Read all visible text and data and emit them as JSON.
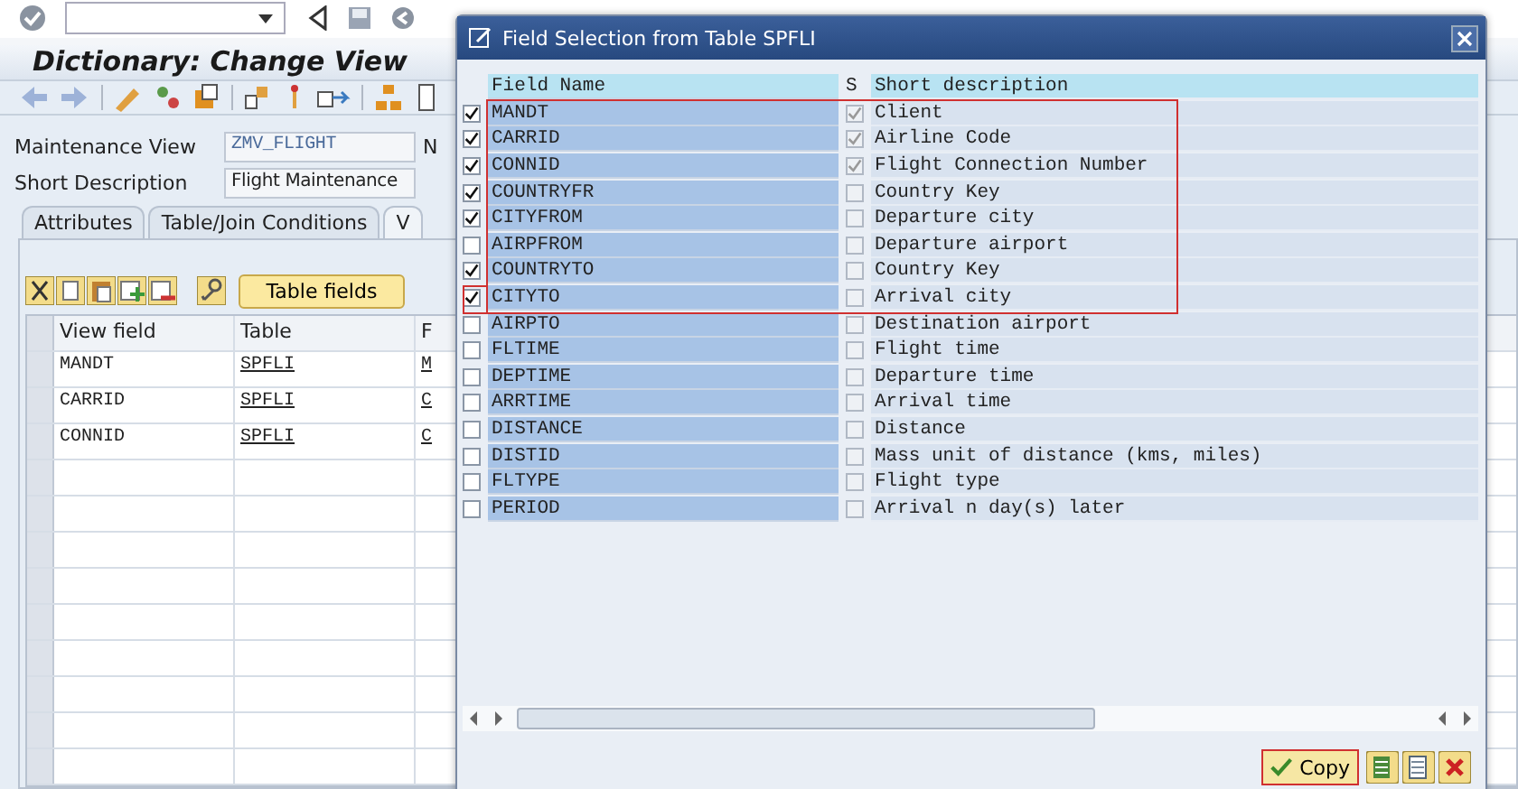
{
  "main": {
    "title": "Dictionary: Change View",
    "fields": [
      {
        "label": "Maintenance View",
        "value": "ZMV_FLIGHT",
        "next_label": "N"
      },
      {
        "label": "Short Description",
        "value": "Flight Maintenance"
      }
    ],
    "tabs": [
      {
        "label": "Attributes",
        "selected": false
      },
      {
        "label": "Table/Join Conditions",
        "selected": false
      },
      {
        "label": "V",
        "selected": true
      }
    ],
    "table_fields_button": "Table fields",
    "table": {
      "columns": [
        "View field",
        "Table",
        "F"
      ],
      "rows": [
        [
          "MANDT",
          "SPFLI",
          "M"
        ],
        [
          "CARRID",
          "SPFLI",
          "C"
        ],
        [
          "CONNID",
          "SPFLI",
          "C"
        ]
      ]
    }
  },
  "dialog": {
    "title": "Field Selection from Table SPFLI",
    "columns": [
      "Field Name",
      "S",
      "Short description"
    ],
    "rows": [
      {
        "name": "MANDT",
        "checked": true,
        "key": true,
        "description": "Client"
      },
      {
        "name": "CARRID",
        "checked": true,
        "key": true,
        "description": "Airline Code"
      },
      {
        "name": "CONNID",
        "checked": true,
        "key": true,
        "description": "Flight Connection Number"
      },
      {
        "name": "COUNTRYFR",
        "checked": true,
        "key": false,
        "description": "Country Key"
      },
      {
        "name": "CITYFROM",
        "checked": true,
        "key": false,
        "description": "Departure city"
      },
      {
        "name": "AIRPFROM",
        "checked": false,
        "key": false,
        "description": "Departure airport"
      },
      {
        "name": "COUNTRYTO",
        "checked": true,
        "key": false,
        "description": "Country Key"
      },
      {
        "name": "CITYTO",
        "checked": true,
        "key": false,
        "description": "Arrival city"
      },
      {
        "name": "AIRPTO",
        "checked": false,
        "key": false,
        "description": "Destination airport"
      },
      {
        "name": "FLTIME",
        "checked": false,
        "key": false,
        "description": "Flight time"
      },
      {
        "name": "DEPTIME",
        "checked": false,
        "key": false,
        "description": "Departure time"
      },
      {
        "name": "ARRTIME",
        "checked": false,
        "key": false,
        "description": "Arrival time"
      },
      {
        "name": "DISTANCE",
        "checked": false,
        "key": false,
        "description": "Distance"
      },
      {
        "name": "DISTID",
        "checked": false,
        "key": false,
        "description": "Mass unit of distance (kms, miles)"
      },
      {
        "name": "FLTYPE",
        "checked": false,
        "key": false,
        "description": "Flight type"
      },
      {
        "name": "PERIOD",
        "checked": false,
        "key": false,
        "description": "Arrival n day(s) later"
      }
    ],
    "copy_button": "Copy"
  }
}
